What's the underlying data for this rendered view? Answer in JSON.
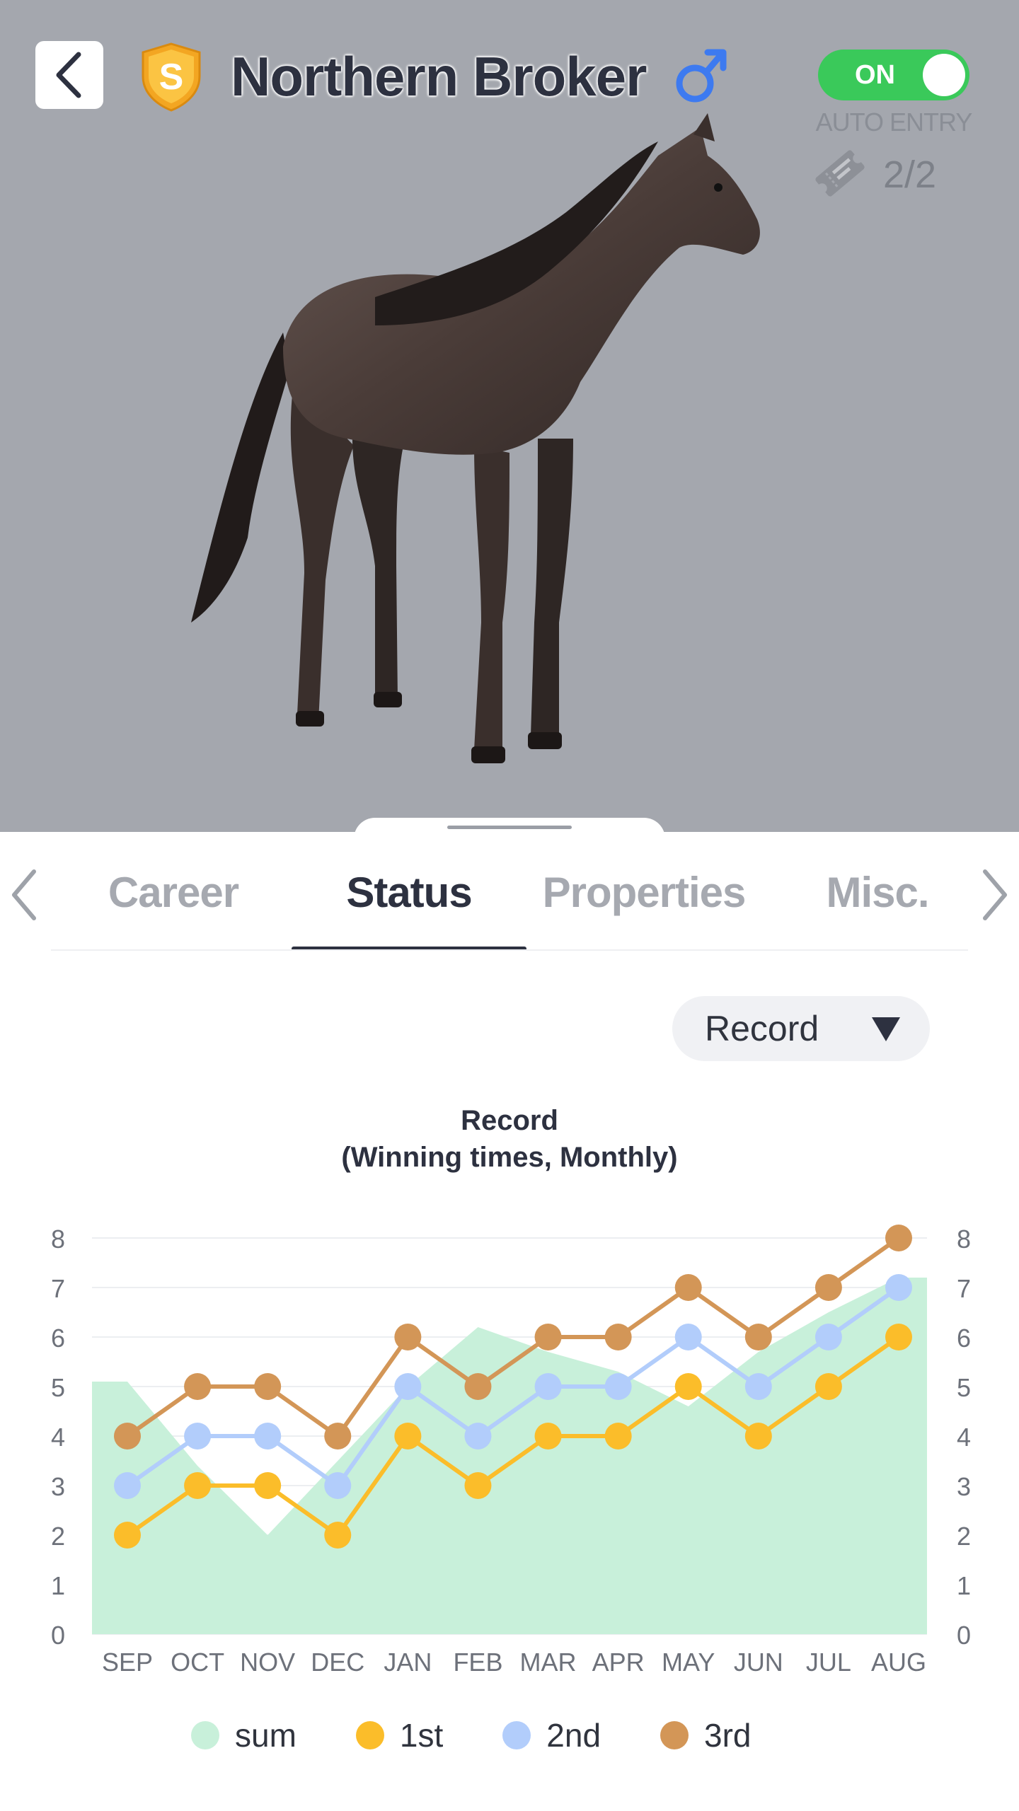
{
  "header": {
    "back_icon": "chevron-left-icon",
    "grade_badge": "S",
    "horse_name": "Northern Broker",
    "gender_icon": "male-symbol-icon",
    "auto_entry_toggle": "ON",
    "auto_entry_label": "AUTO ENTRY",
    "ticket_icon": "ticket-icon",
    "ticket_count": "2/2"
  },
  "tabs": [
    {
      "label": "Career",
      "active": false
    },
    {
      "label": "Status",
      "active": true
    },
    {
      "label": "Properties",
      "active": false
    },
    {
      "label": "Misc.",
      "active": false
    }
  ],
  "dropdown": {
    "selected": "Record",
    "icon": "caret-down-icon"
  },
  "colors": {
    "sum": "#c8f0da",
    "first": "#fbbd2a",
    "second": "#b2cdfb",
    "third": "#d39657",
    "toggle_on": "#3ac95a",
    "gender": "#3d7af0"
  },
  "chart_data": {
    "type": "line",
    "title": "Record",
    "subtitle": "(Winning times, Monthly)",
    "categories": [
      "SEP",
      "OCT",
      "NOV",
      "DEC",
      "JAN",
      "FEB",
      "MAR",
      "APR",
      "MAY",
      "JUN",
      "JUL",
      "AUG"
    ],
    "ylim": [
      0,
      8
    ],
    "yticks": [
      "0",
      "1",
      "2",
      "3",
      "4",
      "5",
      "6",
      "7",
      "8"
    ],
    "grid": true,
    "legend_position": "bottom",
    "series": [
      {
        "name": "sum",
        "kind": "area",
        "values": [
          5.1,
          3.4,
          2.0,
          3.5,
          5.0,
          6.2,
          5.7,
          5.3,
          4.6,
          5.7,
          6.5,
          7.2
        ]
      },
      {
        "name": "1st",
        "kind": "line",
        "values": [
          2,
          3,
          3,
          2,
          4,
          3,
          4,
          4,
          5,
          4,
          5,
          6
        ]
      },
      {
        "name": "2nd",
        "kind": "line",
        "values": [
          3,
          4,
          4,
          3,
          5,
          4,
          5,
          5,
          6,
          5,
          6,
          7
        ]
      },
      {
        "name": "3rd",
        "kind": "line",
        "values": [
          4,
          5,
          5,
          4,
          6,
          5,
          6,
          6,
          7,
          6,
          7,
          8
        ]
      }
    ]
  },
  "legend": [
    {
      "label": "sum",
      "color_key": "sum"
    },
    {
      "label": "1st",
      "color_key": "first"
    },
    {
      "label": "2nd",
      "color_key": "second"
    },
    {
      "label": "3rd",
      "color_key": "third"
    }
  ]
}
